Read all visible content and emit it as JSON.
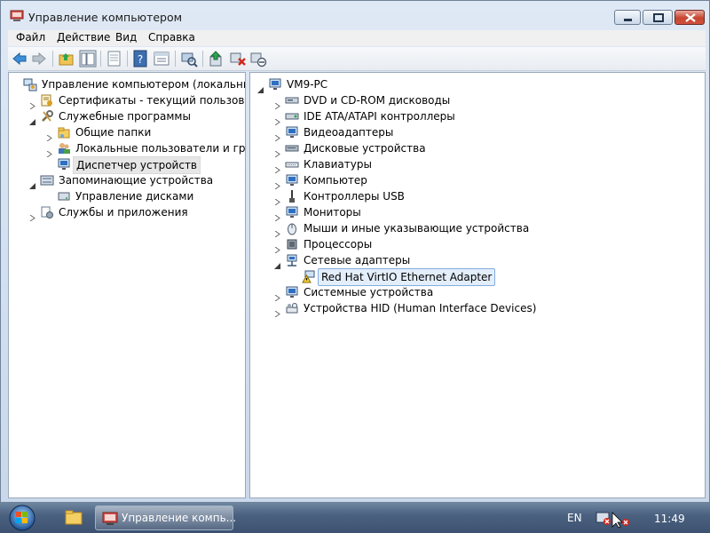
{
  "window": {
    "title": "Управление компьютером"
  },
  "menu": [
    "Файл",
    "Действие",
    "Вид",
    "Справка"
  ],
  "left_tree": [
    {
      "label": "Управление компьютером (локальным)",
      "depth": 0,
      "twisty": "none",
      "icon": "computer-management-icon"
    },
    {
      "label": "Сертификаты - текущий пользователь",
      "depth": 1,
      "twisty": "collapsed",
      "icon": "certificates-icon"
    },
    {
      "label": "Служебные программы",
      "depth": 1,
      "twisty": "expanded",
      "icon": "tools-icon"
    },
    {
      "label": "Общие папки",
      "depth": 2,
      "twisty": "collapsed",
      "icon": "shared-folders-icon"
    },
    {
      "label": "Локальные пользователи и группы",
      "depth": 2,
      "twisty": "collapsed",
      "icon": "users-groups-icon"
    },
    {
      "label": "Диспетчер устройств",
      "depth": 2,
      "twisty": "none",
      "icon": "device-manager-icon",
      "selected": true
    },
    {
      "label": "Запоминающие устройства",
      "depth": 1,
      "twisty": "expanded",
      "icon": "storage-icon"
    },
    {
      "label": "Управление дисками",
      "depth": 2,
      "twisty": "none",
      "icon": "disk-management-icon"
    },
    {
      "label": "Службы и приложения",
      "depth": 1,
      "twisty": "collapsed",
      "icon": "services-apps-icon"
    }
  ],
  "right_tree": [
    {
      "label": "VM9-PC",
      "depth": 0,
      "twisty": "expanded",
      "icon": "computer-icon"
    },
    {
      "label": "DVD и CD-ROM дисководы",
      "depth": 1,
      "twisty": "collapsed",
      "icon": "dvd-drive-icon"
    },
    {
      "label": "IDE ATA/ATAPI контроллеры",
      "depth": 1,
      "twisty": "collapsed",
      "icon": "ide-controller-icon"
    },
    {
      "label": "Видеоадаптеры",
      "depth": 1,
      "twisty": "collapsed",
      "icon": "display-adapter-icon"
    },
    {
      "label": "Дисковые устройства",
      "depth": 1,
      "twisty": "collapsed",
      "icon": "disk-drive-icon"
    },
    {
      "label": "Клавиатуры",
      "depth": 1,
      "twisty": "collapsed",
      "icon": "keyboard-icon"
    },
    {
      "label": "Компьютер",
      "depth": 1,
      "twisty": "collapsed",
      "icon": "computer-icon"
    },
    {
      "label": "Контроллеры USB",
      "depth": 1,
      "twisty": "collapsed",
      "icon": "usb-icon"
    },
    {
      "label": "Мониторы",
      "depth": 1,
      "twisty": "collapsed",
      "icon": "monitor-icon"
    },
    {
      "label": "Мыши и иные указывающие устройства",
      "depth": 1,
      "twisty": "collapsed",
      "icon": "mouse-icon"
    },
    {
      "label": "Процессоры",
      "depth": 1,
      "twisty": "collapsed",
      "icon": "processor-icon"
    },
    {
      "label": "Сетевые адаптеры",
      "depth": 1,
      "twisty": "expanded",
      "icon": "network-adapter-icon"
    },
    {
      "label": "Red Hat VirtIO Ethernet Adapter",
      "depth": 2,
      "twisty": "none",
      "icon": "network-adapter-warning-icon",
      "selected": true
    },
    {
      "label": "Системные устройства",
      "depth": 1,
      "twisty": "collapsed",
      "icon": "system-devices-icon"
    },
    {
      "label": "Устройства HID (Human Interface Devices)",
      "depth": 1,
      "twisty": "collapsed",
      "icon": "hid-icon"
    }
  ],
  "taskbar": {
    "task_label": "Управление компь...",
    "language": "EN",
    "clock": "11:49"
  },
  "colors": {
    "selection_blue": "#e3eefb",
    "selection_border": "#84acdd",
    "title_accent": "#c6452f"
  }
}
